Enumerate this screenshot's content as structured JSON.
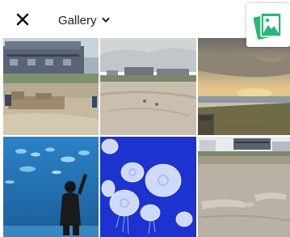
{
  "header": {
    "album_label": "Gallery",
    "close_icon": "close-icon",
    "dropdown_icon": "chevron-down-icon",
    "app_icon": "gallery-app-icon"
  },
  "colors": {
    "accent_green": "#2bb673",
    "header_divider": "#e04b4b"
  },
  "photos": [
    {
      "name": "photo-beach-house-sandcastle"
    },
    {
      "name": "photo-beach-houses-cloudy"
    },
    {
      "name": "photo-beach-sunset"
    },
    {
      "name": "photo-aquarium-child"
    },
    {
      "name": "photo-jellyfish"
    },
    {
      "name": "photo-sand-sculpture"
    }
  ]
}
